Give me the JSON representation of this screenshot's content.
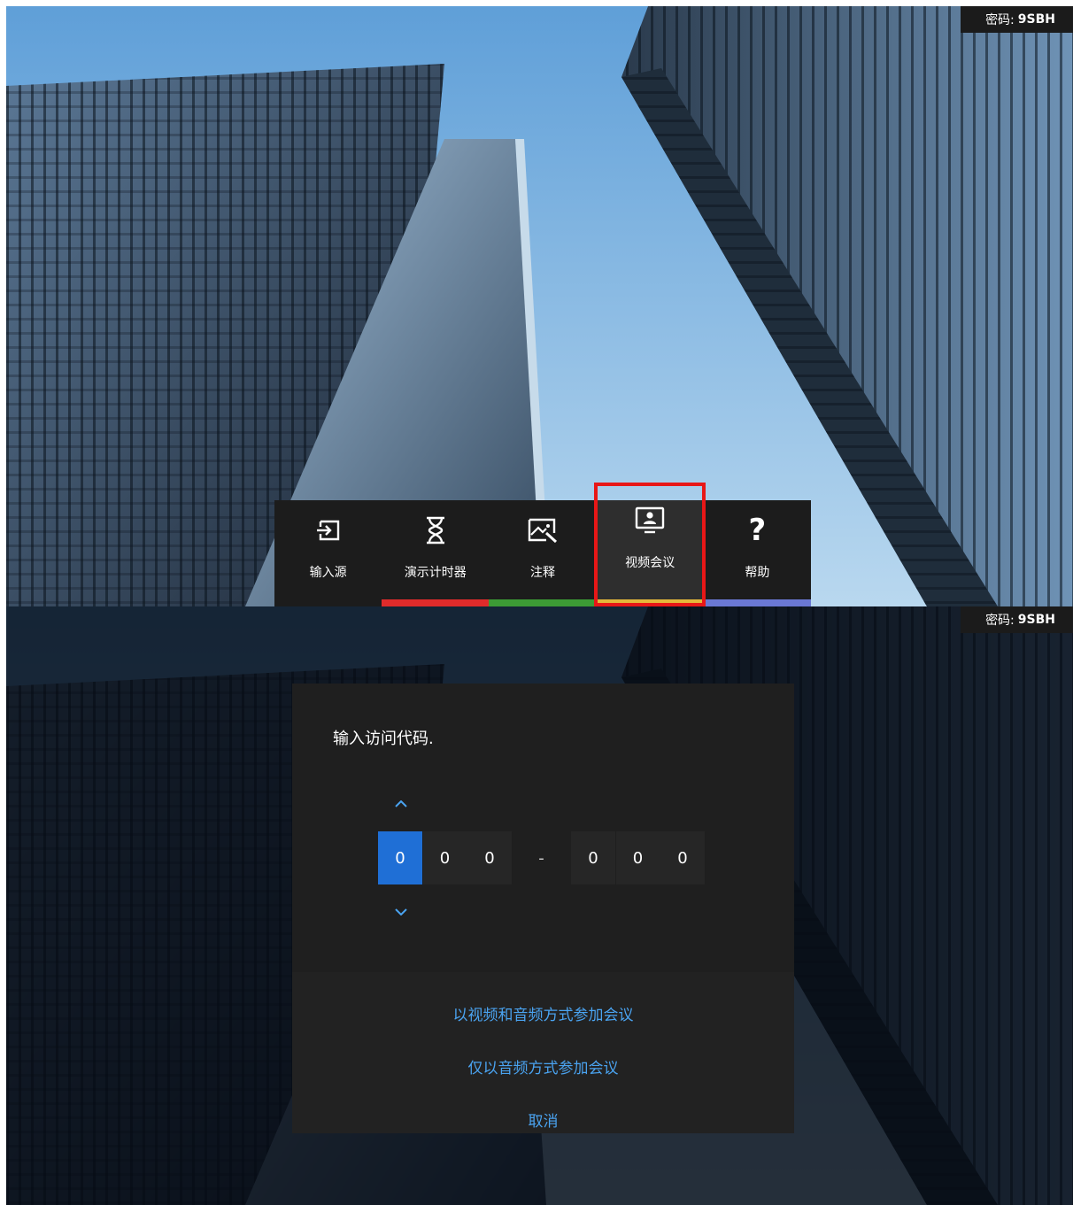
{
  "password": {
    "label": "密码:",
    "code": "9SBH"
  },
  "dock": {
    "items": [
      {
        "label": "输入源",
        "icon": "input-source-icon"
      },
      {
        "label": "演示计时器",
        "icon": "hourglass-icon"
      },
      {
        "label": "注释",
        "icon": "annotate-image-icon"
      },
      {
        "label": "视频会议",
        "icon": "video-conference-icon"
      },
      {
        "label": "帮助",
        "icon": "help-icon"
      }
    ],
    "bar_colors": [
      "#e02b2b",
      "#3c9b35",
      "#e5b83a",
      "#6a78d4"
    ],
    "highlight_color": "#e81717"
  },
  "dialog": {
    "title": "输入访问代码.",
    "digits_left": [
      "0",
      "0",
      "0"
    ],
    "separator": "-",
    "digits_right": [
      "0",
      "0",
      "0"
    ],
    "actions": {
      "video_audio": "以视频和音频方式参加会议",
      "audio_only": "仅以音频方式参加会议",
      "cancel": "取消"
    },
    "accent_color": "#1f6fd6",
    "link_color": "#4aa3f0"
  }
}
